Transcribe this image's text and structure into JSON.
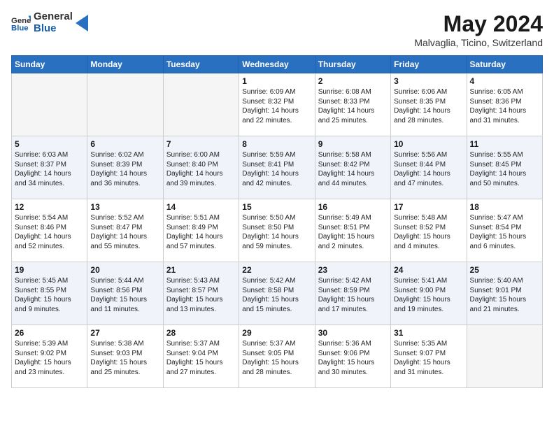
{
  "header": {
    "logo_general": "General",
    "logo_blue": "Blue",
    "month_title": "May 2024",
    "subtitle": "Malvaglia, Ticino, Switzerland"
  },
  "days_of_week": [
    "Sunday",
    "Monday",
    "Tuesday",
    "Wednesday",
    "Thursday",
    "Friday",
    "Saturday"
  ],
  "weeks": [
    [
      {
        "day": "",
        "empty": true
      },
      {
        "day": "",
        "empty": true
      },
      {
        "day": "",
        "empty": true
      },
      {
        "day": "1",
        "sunrise": "6:09 AM",
        "sunset": "8:32 PM",
        "daylight": "14 hours and 22 minutes."
      },
      {
        "day": "2",
        "sunrise": "6:08 AM",
        "sunset": "8:33 PM",
        "daylight": "14 hours and 25 minutes."
      },
      {
        "day": "3",
        "sunrise": "6:06 AM",
        "sunset": "8:35 PM",
        "daylight": "14 hours and 28 minutes."
      },
      {
        "day": "4",
        "sunrise": "6:05 AM",
        "sunset": "8:36 PM",
        "daylight": "14 hours and 31 minutes."
      }
    ],
    [
      {
        "day": "5",
        "sunrise": "6:03 AM",
        "sunset": "8:37 PM",
        "daylight": "14 hours and 34 minutes."
      },
      {
        "day": "6",
        "sunrise": "6:02 AM",
        "sunset": "8:39 PM",
        "daylight": "14 hours and 36 minutes."
      },
      {
        "day": "7",
        "sunrise": "6:00 AM",
        "sunset": "8:40 PM",
        "daylight": "14 hours and 39 minutes."
      },
      {
        "day": "8",
        "sunrise": "5:59 AM",
        "sunset": "8:41 PM",
        "daylight": "14 hours and 42 minutes."
      },
      {
        "day": "9",
        "sunrise": "5:58 AM",
        "sunset": "8:42 PM",
        "daylight": "14 hours and 44 minutes."
      },
      {
        "day": "10",
        "sunrise": "5:56 AM",
        "sunset": "8:44 PM",
        "daylight": "14 hours and 47 minutes."
      },
      {
        "day": "11",
        "sunrise": "5:55 AM",
        "sunset": "8:45 PM",
        "daylight": "14 hours and 50 minutes."
      }
    ],
    [
      {
        "day": "12",
        "sunrise": "5:54 AM",
        "sunset": "8:46 PM",
        "daylight": "14 hours and 52 minutes."
      },
      {
        "day": "13",
        "sunrise": "5:52 AM",
        "sunset": "8:47 PM",
        "daylight": "14 hours and 55 minutes."
      },
      {
        "day": "14",
        "sunrise": "5:51 AM",
        "sunset": "8:49 PM",
        "daylight": "14 hours and 57 minutes."
      },
      {
        "day": "15",
        "sunrise": "5:50 AM",
        "sunset": "8:50 PM",
        "daylight": "14 hours and 59 minutes."
      },
      {
        "day": "16",
        "sunrise": "5:49 AM",
        "sunset": "8:51 PM",
        "daylight": "15 hours and 2 minutes."
      },
      {
        "day": "17",
        "sunrise": "5:48 AM",
        "sunset": "8:52 PM",
        "daylight": "15 hours and 4 minutes."
      },
      {
        "day": "18",
        "sunrise": "5:47 AM",
        "sunset": "8:54 PM",
        "daylight": "15 hours and 6 minutes."
      }
    ],
    [
      {
        "day": "19",
        "sunrise": "5:45 AM",
        "sunset": "8:55 PM",
        "daylight": "15 hours and 9 minutes."
      },
      {
        "day": "20",
        "sunrise": "5:44 AM",
        "sunset": "8:56 PM",
        "daylight": "15 hours and 11 minutes."
      },
      {
        "day": "21",
        "sunrise": "5:43 AM",
        "sunset": "8:57 PM",
        "daylight": "15 hours and 13 minutes."
      },
      {
        "day": "22",
        "sunrise": "5:42 AM",
        "sunset": "8:58 PM",
        "daylight": "15 hours and 15 minutes."
      },
      {
        "day": "23",
        "sunrise": "5:42 AM",
        "sunset": "8:59 PM",
        "daylight": "15 hours and 17 minutes."
      },
      {
        "day": "24",
        "sunrise": "5:41 AM",
        "sunset": "9:00 PM",
        "daylight": "15 hours and 19 minutes."
      },
      {
        "day": "25",
        "sunrise": "5:40 AM",
        "sunset": "9:01 PM",
        "daylight": "15 hours and 21 minutes."
      }
    ],
    [
      {
        "day": "26",
        "sunrise": "5:39 AM",
        "sunset": "9:02 PM",
        "daylight": "15 hours and 23 minutes."
      },
      {
        "day": "27",
        "sunrise": "5:38 AM",
        "sunset": "9:03 PM",
        "daylight": "15 hours and 25 minutes."
      },
      {
        "day": "28",
        "sunrise": "5:37 AM",
        "sunset": "9:04 PM",
        "daylight": "15 hours and 27 minutes."
      },
      {
        "day": "29",
        "sunrise": "5:37 AM",
        "sunset": "9:05 PM",
        "daylight": "15 hours and 28 minutes."
      },
      {
        "day": "30",
        "sunrise": "5:36 AM",
        "sunset": "9:06 PM",
        "daylight": "15 hours and 30 minutes."
      },
      {
        "day": "31",
        "sunrise": "5:35 AM",
        "sunset": "9:07 PM",
        "daylight": "15 hours and 31 minutes."
      },
      {
        "day": "",
        "empty": true
      }
    ]
  ]
}
